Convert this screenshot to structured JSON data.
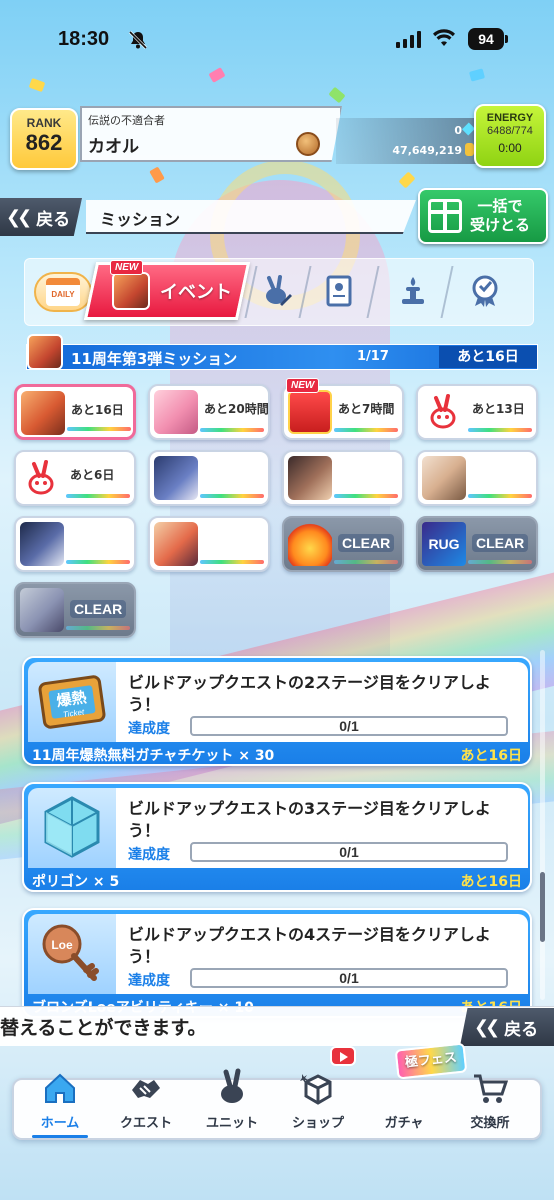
{
  "status_bar": {
    "time": "18:30",
    "battery": "94"
  },
  "header": {
    "rank_label": "RANK",
    "rank_value": "862",
    "player_title": "伝説の不適合者",
    "player_name": "カオル",
    "gems": "0",
    "coins": "47,649,219",
    "energy_label": "ENERGY",
    "energy_value": "6488/774",
    "energy_timer": "0:00"
  },
  "nav": {
    "back_label": "戻る",
    "page_title": "ミッション",
    "bulk_receive_label_1": "一括で",
    "bulk_receive_label_2": "受けとる"
  },
  "tabs": {
    "daily_label": "DAILY",
    "event_label": "イベント",
    "new_badge": "NEW"
  },
  "mission_group": {
    "title": "11周年第3弾ミッション",
    "progress": "1/17",
    "remaining": "あと16日"
  },
  "cards": [
    {
      "label": "あと16日",
      "state": "active",
      "thumb": "a"
    },
    {
      "label": "あと20時間",
      "state": "normal",
      "thumb": "b"
    },
    {
      "label": "あと7時間",
      "state": "normal",
      "thumb": "gift",
      "new": "NEW"
    },
    {
      "label": "あと13日",
      "state": "normal",
      "thumb": "rab"
    },
    {
      "label": "あと6日",
      "state": "normal",
      "thumb": "rab"
    },
    {
      "label": "",
      "state": "normal",
      "thumb": "c"
    },
    {
      "label": "",
      "state": "normal",
      "thumb": "d"
    },
    {
      "label": "",
      "state": "normal",
      "thumb": "e"
    },
    {
      "label": "",
      "state": "normal",
      "thumb": "f"
    },
    {
      "label": "",
      "state": "normal",
      "thumb": "g"
    },
    {
      "label": "CLEAR",
      "state": "clear",
      "thumb": "fire"
    },
    {
      "label": "CLEAR",
      "state": "clear",
      "thumb": "logo",
      "logo_text": "RUG"
    },
    {
      "label": "CLEAR",
      "state": "clear",
      "thumb": "h"
    }
  ],
  "missions": [
    {
      "description": "ビルドアップクエストの2ステージ目をクリアしよう！",
      "progress_label": "達成度",
      "progress": "0/1",
      "progress_fraction": 0,
      "reward": "11周年爆熱無料ガチャチケット × 30",
      "remaining": "あと16日",
      "icon": "ticket-icon",
      "icon_text_1": "爆熱",
      "icon_text_2": "Ticket"
    },
    {
      "description": "ビルドアップクエストの3ステージ目をクリアしよう！",
      "progress_label": "達成度",
      "progress": "0/1",
      "progress_fraction": 0,
      "reward": "ポリゴン × 5",
      "remaining": "あと16日",
      "icon": "polygon-cube-icon"
    },
    {
      "description": "ビルドアップクエストの4ステージ目をクリアしよう！",
      "progress_label": "達成度",
      "progress": "0/1",
      "progress_fraction": 0,
      "reward": "ブロンズLoeアビリティキー × 10",
      "remaining": "あと16日",
      "icon": "bronze-key-icon",
      "icon_text": "Loe"
    }
  ],
  "ticker": {
    "text": "替えることができます。",
    "back_label": "戻る"
  },
  "bottom_nav": [
    {
      "label": "ホーム",
      "icon": "home-icon",
      "active": true
    },
    {
      "label": "クエスト",
      "icon": "quest-handshake-icon",
      "active": false
    },
    {
      "label": "ユニット",
      "icon": "unit-rabbit-icon",
      "active": false
    },
    {
      "label": "ショップ",
      "icon": "shop-box-icon",
      "active": false
    },
    {
      "label": "ガチャ",
      "icon": "gacha-icon",
      "active": false
    },
    {
      "label": "交換所",
      "icon": "exchange-cart-icon",
      "active": false
    }
  ],
  "fes_badge": "極フェス",
  "colors": {
    "accent_blue": "#1a7fe8",
    "event_red": "#e8193f",
    "bulk_green": "#179a44",
    "remaining_yellow": "#ffe24a"
  }
}
